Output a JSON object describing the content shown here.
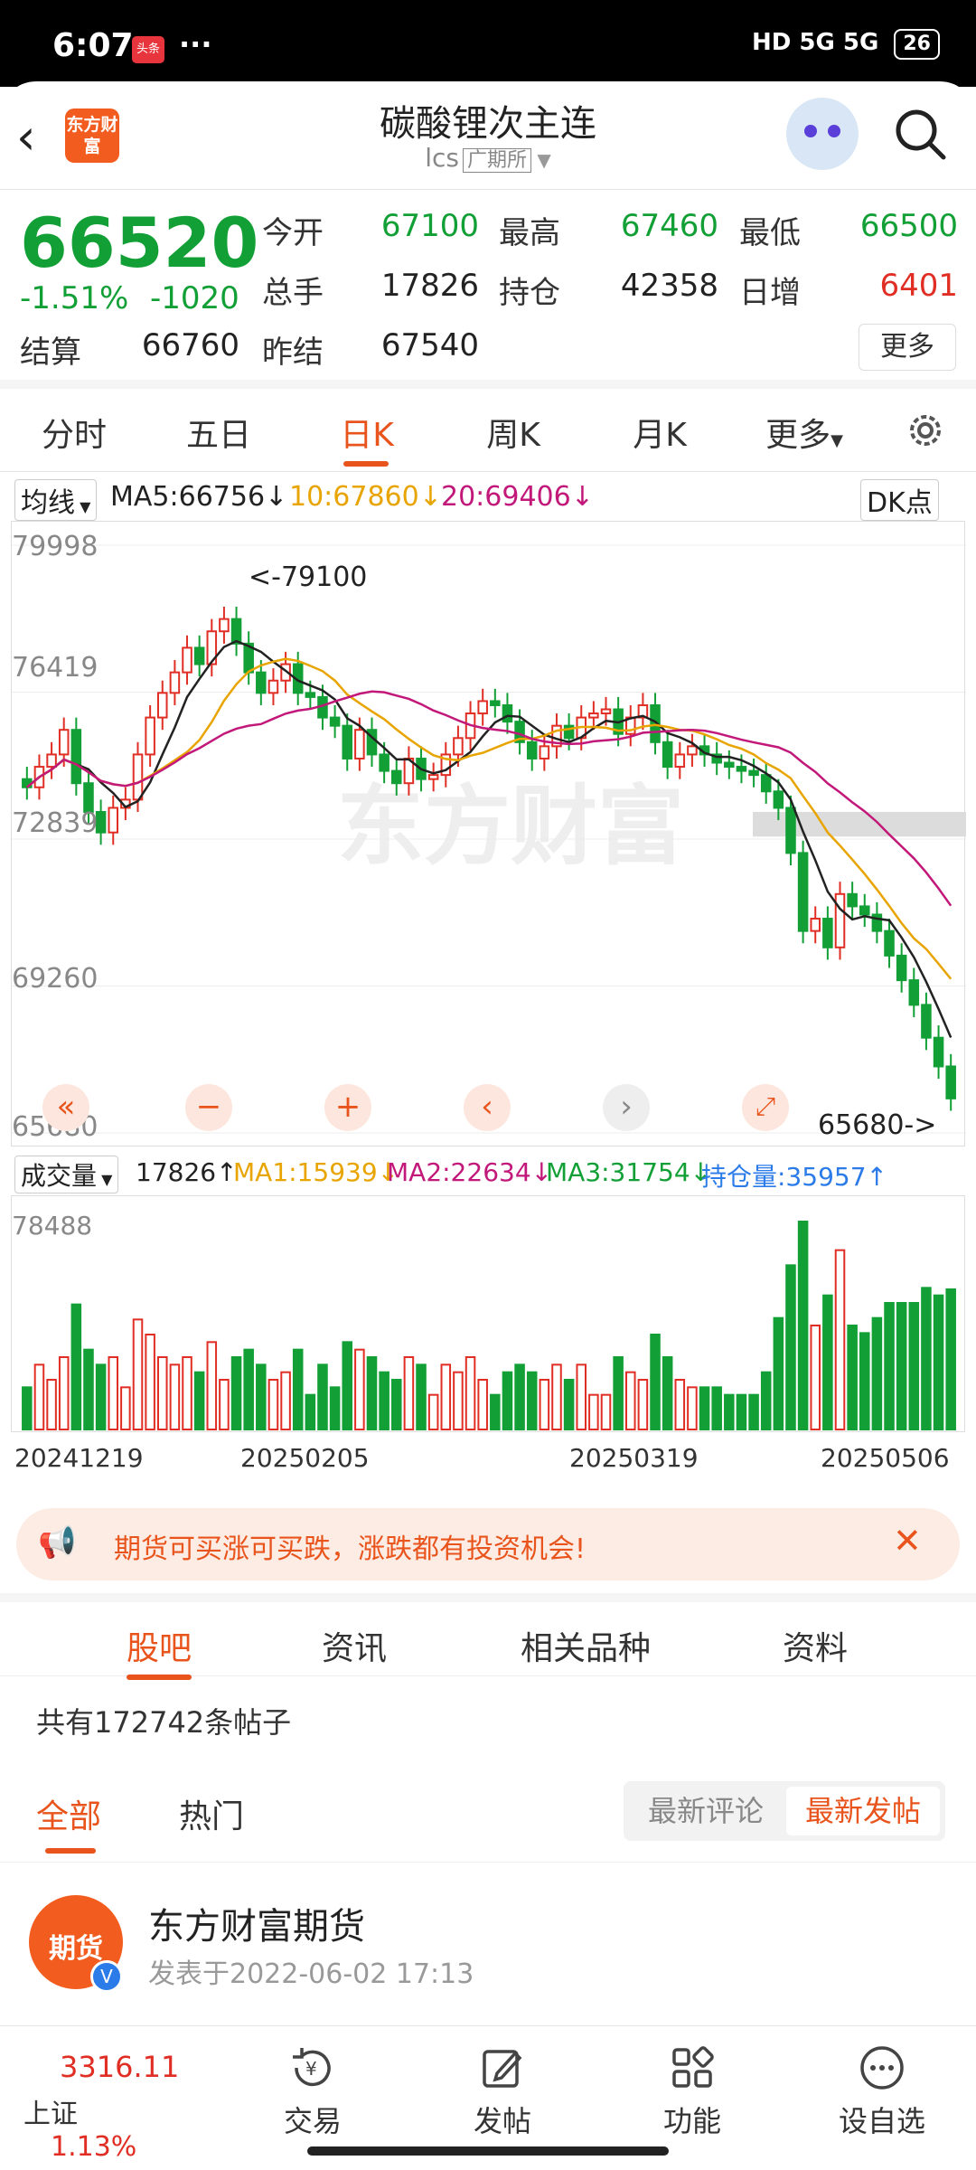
{
  "status": {
    "time": "6:07",
    "news_badge": "头条",
    "dots": "···",
    "signal": "HD 5G 5G",
    "battery": "26"
  },
  "header": {
    "logo": "东方财富",
    "title": "碳酸锂次主连",
    "code": "lcs",
    "exchange": "广期所"
  },
  "quote": {
    "price": "66520",
    "change_pct": "-1.51%",
    "change": "-1020",
    "fields": [
      {
        "label": "今开",
        "value": "67100",
        "color": "green"
      },
      {
        "label": "最高",
        "value": "67460",
        "color": "green"
      },
      {
        "label": "最低",
        "value": "66500",
        "color": "green"
      },
      {
        "label": "总手",
        "value": "17826",
        "color": "dark"
      },
      {
        "label": "持仓",
        "value": "42358",
        "color": "dark"
      },
      {
        "label": "日增",
        "value": "6401",
        "color": "red"
      },
      {
        "label": "结算",
        "value": "66760",
        "color": "dark"
      },
      {
        "label": "昨结",
        "value": "67540",
        "color": "dark"
      }
    ],
    "more": "更多"
  },
  "tabs": [
    "分时",
    "五日",
    "日K",
    "周K",
    "月K",
    "更多"
  ],
  "active_tab": "日K",
  "ma": {
    "selector": "均线",
    "ma5": "MA5:66756",
    "ma10": "10:67860",
    "ma20": "20:69406",
    "dk": "DK点",
    "c5": "#222222",
    "c10": "#e8a400",
    "c20": "#c2187a"
  },
  "chart_data": {
    "type": "candlestick",
    "y_ticks": [
      "79998",
      "76419",
      "72839",
      "69260",
      "65680"
    ],
    "ylim": [
      65680,
      79998
    ],
    "high_annot": "<-79100",
    "low_annot": "65680->",
    "watermark": "东方财富",
    "closes": [
      74100,
      74600,
      74900,
      75500,
      74200,
      73500,
      73000,
      73600,
      73800,
      74900,
      75800,
      76400,
      76900,
      77500,
      77100,
      77900,
      78200,
      77600,
      76900,
      76400,
      76700,
      77100,
      76400,
      76300,
      75800,
      75600,
      74800,
      75500,
      74900,
      74500,
      74200,
      74800,
      74300,
      74400,
      74900,
      75300,
      75900,
      76200,
      76100,
      75700,
      75200,
      74800,
      75100,
      75600,
      75300,
      75800,
      75900,
      76000,
      75400,
      75800,
      76100,
      75200,
      74600,
      74900,
      75100,
      74900,
      74700,
      74600,
      74500,
      74400,
      74000,
      73600,
      72500,
      70600,
      70900,
      70200,
      71500,
      71200,
      71000,
      70600,
      70000,
      69400,
      68800,
      68000,
      67300,
      66520
    ]
  },
  "volume": {
    "selector": "成交量",
    "vol": "17826",
    "ma1": "MA1:15939",
    "ma2": "MA2:22634",
    "ma3": "MA3:31754",
    "oi": "持仓量:35957",
    "top_tick": "78488",
    "dates": [
      "20241219",
      "20250205",
      "20250319",
      "20250506"
    ]
  },
  "banner": {
    "text": "期货可买涨可买跌，涨跌都有投资机会!"
  },
  "section_tabs": [
    "股吧",
    "资讯",
    "相关品种",
    "资料"
  ],
  "post_count": "共有172742条帖子",
  "filters": {
    "all": "全部",
    "hot": "热门",
    "latest_comment": "最新评论",
    "latest_post": "最新发帖"
  },
  "post": {
    "avatar_text": "期货",
    "author": "东方财富期货",
    "time": "发表于2022-06-02 17:13"
  },
  "bottom": {
    "index_value": "3316.11",
    "index_name": "上证",
    "index_change": "1.13%",
    "trade": "交易",
    "post": "发帖",
    "func": "功能",
    "watch": "设自选"
  }
}
